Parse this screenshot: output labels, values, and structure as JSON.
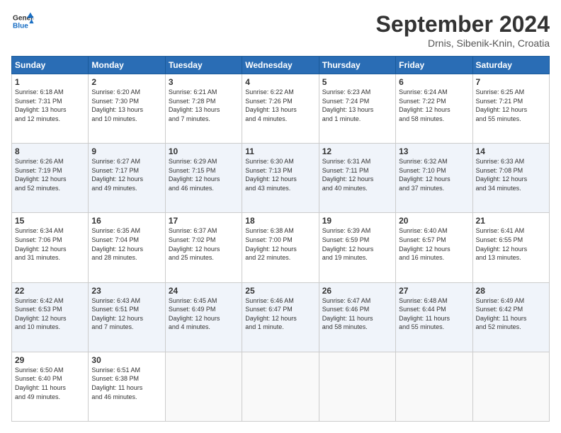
{
  "header": {
    "logo_line1": "General",
    "logo_line2": "Blue",
    "month_title": "September 2024",
    "location": "Drnis, Sibenik-Knin, Croatia"
  },
  "days_of_week": [
    "Sunday",
    "Monday",
    "Tuesday",
    "Wednesday",
    "Thursday",
    "Friday",
    "Saturday"
  ],
  "weeks": [
    [
      {
        "day": "1",
        "info": "Sunrise: 6:18 AM\nSunset: 7:31 PM\nDaylight: 13 hours\nand 12 minutes."
      },
      {
        "day": "2",
        "info": "Sunrise: 6:20 AM\nSunset: 7:30 PM\nDaylight: 13 hours\nand 10 minutes."
      },
      {
        "day": "3",
        "info": "Sunrise: 6:21 AM\nSunset: 7:28 PM\nDaylight: 13 hours\nand 7 minutes."
      },
      {
        "day": "4",
        "info": "Sunrise: 6:22 AM\nSunset: 7:26 PM\nDaylight: 13 hours\nand 4 minutes."
      },
      {
        "day": "5",
        "info": "Sunrise: 6:23 AM\nSunset: 7:24 PM\nDaylight: 13 hours\nand 1 minute."
      },
      {
        "day": "6",
        "info": "Sunrise: 6:24 AM\nSunset: 7:22 PM\nDaylight: 12 hours\nand 58 minutes."
      },
      {
        "day": "7",
        "info": "Sunrise: 6:25 AM\nSunset: 7:21 PM\nDaylight: 12 hours\nand 55 minutes."
      }
    ],
    [
      {
        "day": "8",
        "info": "Sunrise: 6:26 AM\nSunset: 7:19 PM\nDaylight: 12 hours\nand 52 minutes."
      },
      {
        "day": "9",
        "info": "Sunrise: 6:27 AM\nSunset: 7:17 PM\nDaylight: 12 hours\nand 49 minutes."
      },
      {
        "day": "10",
        "info": "Sunrise: 6:29 AM\nSunset: 7:15 PM\nDaylight: 12 hours\nand 46 minutes."
      },
      {
        "day": "11",
        "info": "Sunrise: 6:30 AM\nSunset: 7:13 PM\nDaylight: 12 hours\nand 43 minutes."
      },
      {
        "day": "12",
        "info": "Sunrise: 6:31 AM\nSunset: 7:11 PM\nDaylight: 12 hours\nand 40 minutes."
      },
      {
        "day": "13",
        "info": "Sunrise: 6:32 AM\nSunset: 7:10 PM\nDaylight: 12 hours\nand 37 minutes."
      },
      {
        "day": "14",
        "info": "Sunrise: 6:33 AM\nSunset: 7:08 PM\nDaylight: 12 hours\nand 34 minutes."
      }
    ],
    [
      {
        "day": "15",
        "info": "Sunrise: 6:34 AM\nSunset: 7:06 PM\nDaylight: 12 hours\nand 31 minutes."
      },
      {
        "day": "16",
        "info": "Sunrise: 6:35 AM\nSunset: 7:04 PM\nDaylight: 12 hours\nand 28 minutes."
      },
      {
        "day": "17",
        "info": "Sunrise: 6:37 AM\nSunset: 7:02 PM\nDaylight: 12 hours\nand 25 minutes."
      },
      {
        "day": "18",
        "info": "Sunrise: 6:38 AM\nSunset: 7:00 PM\nDaylight: 12 hours\nand 22 minutes."
      },
      {
        "day": "19",
        "info": "Sunrise: 6:39 AM\nSunset: 6:59 PM\nDaylight: 12 hours\nand 19 minutes."
      },
      {
        "day": "20",
        "info": "Sunrise: 6:40 AM\nSunset: 6:57 PM\nDaylight: 12 hours\nand 16 minutes."
      },
      {
        "day": "21",
        "info": "Sunrise: 6:41 AM\nSunset: 6:55 PM\nDaylight: 12 hours\nand 13 minutes."
      }
    ],
    [
      {
        "day": "22",
        "info": "Sunrise: 6:42 AM\nSunset: 6:53 PM\nDaylight: 12 hours\nand 10 minutes."
      },
      {
        "day": "23",
        "info": "Sunrise: 6:43 AM\nSunset: 6:51 PM\nDaylight: 12 hours\nand 7 minutes."
      },
      {
        "day": "24",
        "info": "Sunrise: 6:45 AM\nSunset: 6:49 PM\nDaylight: 12 hours\nand 4 minutes."
      },
      {
        "day": "25",
        "info": "Sunrise: 6:46 AM\nSunset: 6:47 PM\nDaylight: 12 hours\nand 1 minute."
      },
      {
        "day": "26",
        "info": "Sunrise: 6:47 AM\nSunset: 6:46 PM\nDaylight: 11 hours\nand 58 minutes."
      },
      {
        "day": "27",
        "info": "Sunrise: 6:48 AM\nSunset: 6:44 PM\nDaylight: 11 hours\nand 55 minutes."
      },
      {
        "day": "28",
        "info": "Sunrise: 6:49 AM\nSunset: 6:42 PM\nDaylight: 11 hours\nand 52 minutes."
      }
    ],
    [
      {
        "day": "29",
        "info": "Sunrise: 6:50 AM\nSunset: 6:40 PM\nDaylight: 11 hours\nand 49 minutes."
      },
      {
        "day": "30",
        "info": "Sunrise: 6:51 AM\nSunset: 6:38 PM\nDaylight: 11 hours\nand 46 minutes."
      },
      {
        "day": "",
        "info": ""
      },
      {
        "day": "",
        "info": ""
      },
      {
        "day": "",
        "info": ""
      },
      {
        "day": "",
        "info": ""
      },
      {
        "day": "",
        "info": ""
      }
    ]
  ]
}
